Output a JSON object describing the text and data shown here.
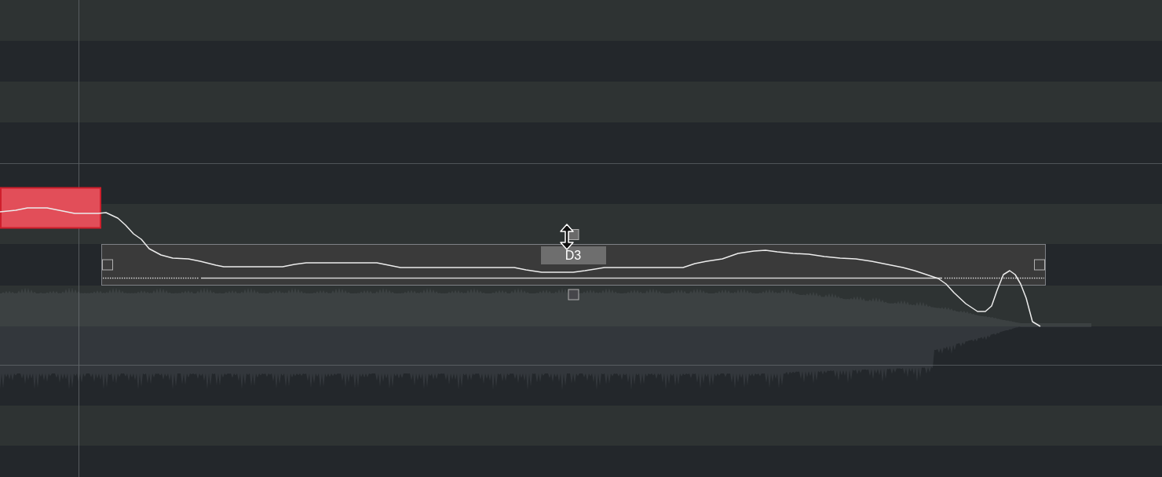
{
  "editor": {
    "notes": [
      {
        "selected": true,
        "hovered": false
      },
      {
        "selected": false,
        "hovered": true,
        "label": "D3"
      }
    ]
  }
}
